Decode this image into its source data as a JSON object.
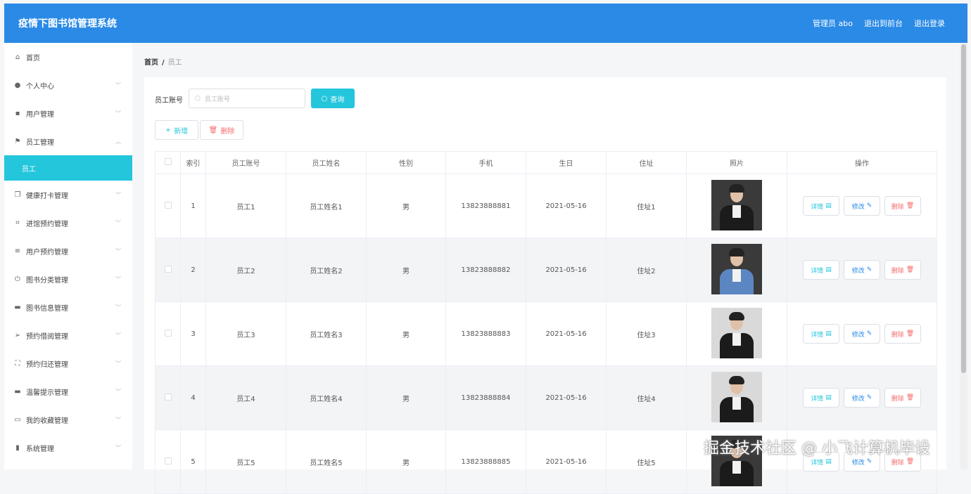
{
  "header": {
    "title": "疫情下图书馆管理系统",
    "admin": "管理员 abo",
    "to_front": "退出到前台",
    "logout": "退出登录"
  },
  "sidebar": {
    "items": [
      {
        "label": "首页",
        "icon": "home-icon",
        "glyph": "⌂"
      },
      {
        "label": "个人中心",
        "icon": "user-icon",
        "glyph": "●"
      },
      {
        "label": "用户管理",
        "icon": "users-icon",
        "glyph": "▪"
      },
      {
        "label": "员工管理",
        "icon": "flag-icon",
        "glyph": "⚑"
      },
      {
        "label": "员工",
        "icon": "",
        "glyph": ""
      },
      {
        "label": "健康打卡管理",
        "icon": "copy-icon",
        "glyph": "❐"
      },
      {
        "label": "进馆预约管理",
        "icon": "crop-icon",
        "glyph": "⌗"
      },
      {
        "label": "用户预约管理",
        "icon": "list-icon",
        "glyph": "≡"
      },
      {
        "label": "图书分类管理",
        "icon": "power-icon",
        "glyph": "⏻"
      },
      {
        "label": "图书信息管理",
        "icon": "comment-icon",
        "glyph": "▬"
      },
      {
        "label": "预约借阅管理",
        "icon": "send-icon",
        "glyph": "➢"
      },
      {
        "label": "预约归还管理",
        "icon": "full-screen-icon",
        "glyph": "⛶"
      },
      {
        "label": "温馨提示管理",
        "icon": "monitor-icon",
        "glyph": "▬"
      },
      {
        "label": "我的收藏管理",
        "icon": "message-icon",
        "glyph": "▭"
      },
      {
        "label": "系统管理",
        "icon": "chart-icon",
        "glyph": "▮"
      }
    ]
  },
  "breadcrumb": {
    "home": "首页",
    "sep": "/",
    "current": "员工"
  },
  "search": {
    "label": "员工账号",
    "placeholder": "员工账号",
    "button": "查询"
  },
  "actions": {
    "add": "新增",
    "delete": "删除"
  },
  "table": {
    "headers": [
      "索引",
      "员工账号",
      "员工姓名",
      "性别",
      "手机",
      "生日",
      "住址",
      "照片",
      "操作"
    ],
    "rows": [
      {
        "index": "1",
        "account": "员工1",
        "name": "员工姓名1",
        "gender": "男",
        "phone": "13823888881",
        "birthday": "2021-05-16",
        "address": "住址1"
      },
      {
        "index": "2",
        "account": "员工2",
        "name": "员工姓名2",
        "gender": "男",
        "phone": "13823888882",
        "birthday": "2021-05-16",
        "address": "住址2"
      },
      {
        "index": "3",
        "account": "员工3",
        "name": "员工姓名3",
        "gender": "男",
        "phone": "13823888883",
        "birthday": "2021-05-16",
        "address": "住址3"
      },
      {
        "index": "4",
        "account": "员工4",
        "name": "员工姓名4",
        "gender": "男",
        "phone": "13823888884",
        "birthday": "2021-05-16",
        "address": "住址4"
      },
      {
        "index": "5",
        "account": "员工5",
        "name": "员工姓名5",
        "gender": "男",
        "phone": "13823888885",
        "birthday": "2021-05-16",
        "address": "住址5"
      }
    ],
    "ops": {
      "detail": "详情",
      "edit": "修改",
      "remove": "删除"
    }
  },
  "watermark": "掘金技术社区 @ 小飞计算机毕设",
  "colors": {
    "header": "#2a8ae6",
    "accent": "#24c6dc",
    "danger": "#f56c6c"
  }
}
